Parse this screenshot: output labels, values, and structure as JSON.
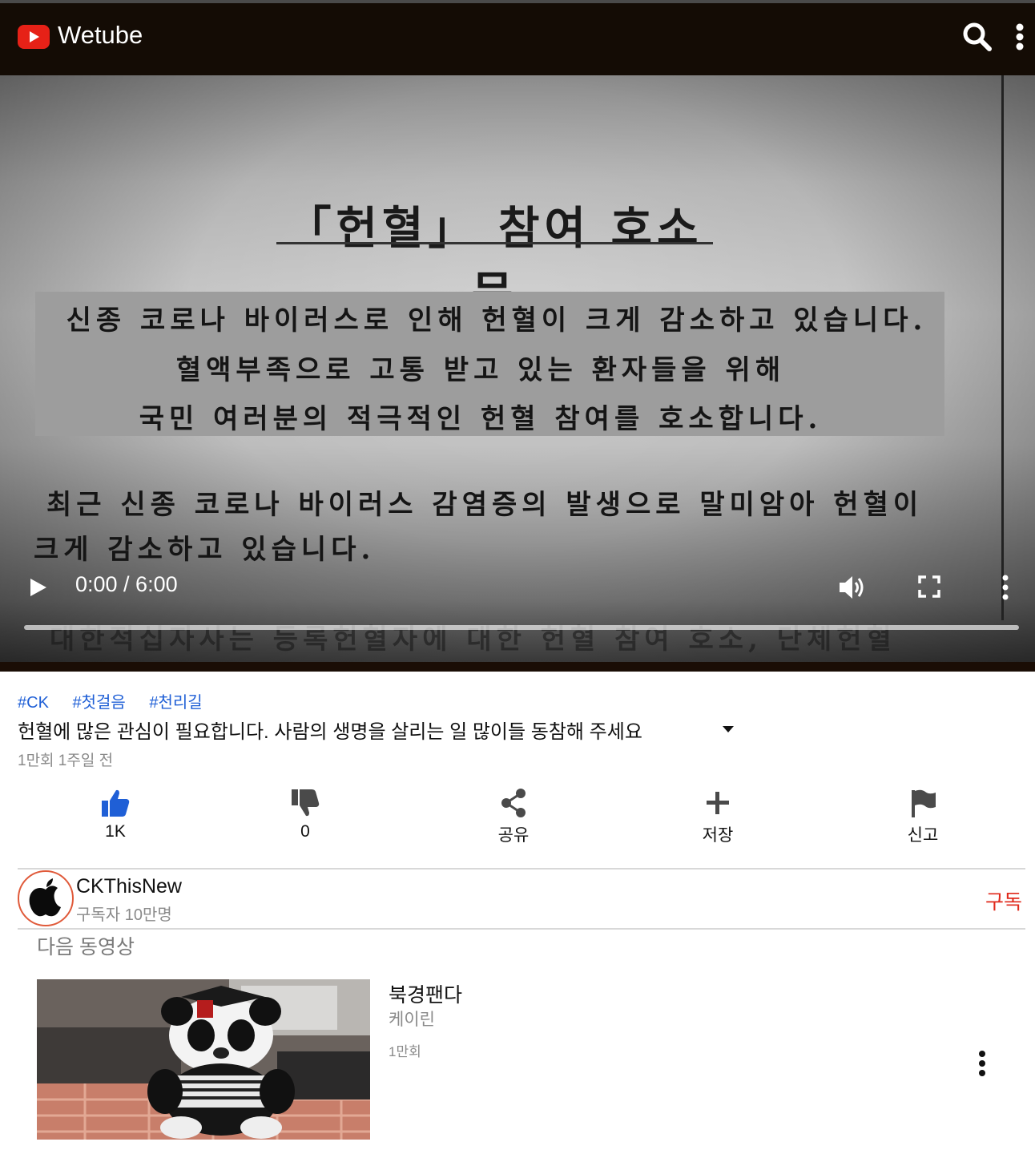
{
  "app": {
    "title": "Wetube"
  },
  "icons": {
    "logo": "play-logo-icon",
    "search": "search-icon",
    "more": "more-vert-icon",
    "play": "play-icon",
    "volume": "volume-icon",
    "fullscreen": "fullscreen-icon",
    "like": "thumbs-up-icon",
    "dislike": "thumbs-down-icon",
    "share": "share-icon",
    "save": "plus-icon",
    "report": "flag-icon",
    "caret": "caret-down-icon"
  },
  "colors": {
    "header_bg": "#140c05",
    "logo_red": "#e62117",
    "hashtag_blue": "#1f5fd6",
    "like_blue": "#1f5fd6",
    "subscribe_red": "#e0291b"
  },
  "video": {
    "poster": {
      "title": "「헌혈」 참여 호소문",
      "box_lines": [
        "신종 코로나 바이러스로 인해 헌혈이 크게 감소하고 있습니다.",
        "혈액부족으로 고통 받고 있는 환자들을 위해",
        "국민 여러분의 적극적인 헌혈 참여를 호소합니다."
      ],
      "body_lines": [
        "최근 신종 코로나 바이러스 감염증의 발생으로 말미암아 헌혈이",
        "크게 감소하고 있습니다.",
        "대한적십자사는 등록헌혈자에 대한 헌혈 참여 호소, 단체헌혈"
      ]
    },
    "time": "0:00 / 6:00",
    "progress": 0.0
  },
  "info": {
    "hashtags": [
      "#CK",
      "#첫걸음",
      "#천리길"
    ],
    "title": "헌혈에 많은 관심이 필요합니다. 사람의 생명을 살리는 일 많이들 동참해 주세요",
    "meta": "1만회 1주일 전"
  },
  "actions": [
    {
      "id": "like",
      "label": "1K"
    },
    {
      "id": "dislike",
      "label": "0"
    },
    {
      "id": "share",
      "label": "공유"
    },
    {
      "id": "save",
      "label": "저장"
    },
    {
      "id": "report",
      "label": "신고"
    }
  ],
  "channel": {
    "name": "CKThisNew",
    "subscribers": "구독자 10만명",
    "subscribe_label": "구독"
  },
  "up_next": {
    "label": "다음 동영상",
    "items": [
      {
        "title": "북경팬다",
        "channel": "케이린",
        "views": "1만회"
      }
    ]
  }
}
